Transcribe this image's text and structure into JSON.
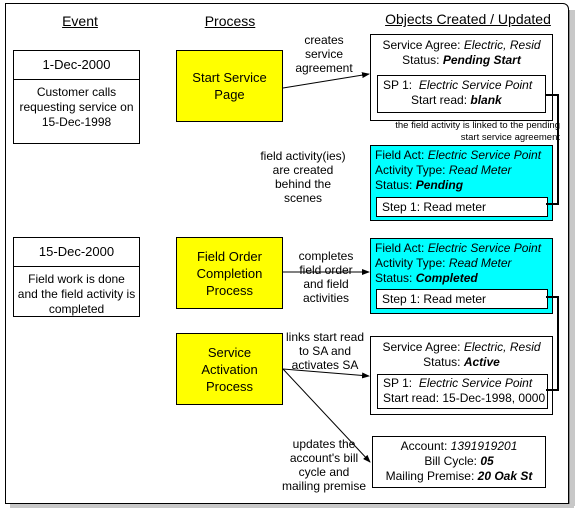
{
  "headers": {
    "event": "Event",
    "process": "Process",
    "objects": "Objects Created / Updated"
  },
  "events": [
    {
      "date": "1-Dec-2000",
      "description_lines": [
        "Customer calls",
        "requesting service on",
        "15-Dec-1998"
      ]
    },
    {
      "date": "15-Dec-2000",
      "description_lines": [
        "Field work is done",
        "and the field activity is",
        "completed"
      ]
    }
  ],
  "processes": [
    {
      "lines": [
        "Start Service",
        "Page"
      ]
    },
    {
      "lines": [
        "Field Order",
        "Completion",
        "Process"
      ]
    },
    {
      "lines": [
        "Service",
        "Activation",
        "Process"
      ]
    }
  ],
  "annotations": {
    "creates_sa": [
      "creates",
      "service",
      "agreement"
    ],
    "field_activity_linked": [
      "the field activity is linked to the pending",
      "start service agreement"
    ],
    "fa_created": [
      "field activity(ies)",
      "are created",
      "behind the",
      "scenes"
    ],
    "completes_fo": [
      "completes",
      "field order",
      "and field",
      "activities"
    ],
    "links_start_read": [
      "links start read",
      "to SA and",
      "activates SA"
    ],
    "updates_account": [
      "updates the",
      "account's bill",
      "cycle and",
      "mailing premise"
    ]
  },
  "objects": {
    "sa_pending": {
      "label1": "Service Agree: ",
      "value1": "Electric, Resid",
      "label2": "Status: ",
      "value2": "Pending Start",
      "sp": {
        "label1": "SP 1:  ",
        "value1": "Electric Service Point",
        "label2": "Start read: ",
        "value2": "blank"
      }
    },
    "fa_pending": {
      "label1": "Field Act: ",
      "value1": "Electric Service Point",
      "label2": "Activity Type: ",
      "value2": "Read Meter",
      "label3": "Status: ",
      "value3": "Pending",
      "step": "Step 1: Read meter"
    },
    "fa_completed": {
      "label1": "Field Act: ",
      "value1": "Electric Service Point",
      "label2": "Activity Type: ",
      "value2": "Read Meter",
      "label3": "Status: ",
      "value3": "Completed",
      "step": "Step 1: Read meter"
    },
    "sa_active": {
      "label1": "Service Agree: ",
      "value1": "Electric, Resid",
      "label2": "Status: ",
      "value2": "Active",
      "sp": {
        "label1": "SP 1:  ",
        "value1": "Electric Service Point",
        "label2": "Start read: ",
        "value2": "15-Dec-1998, 0000"
      }
    },
    "account": {
      "label1": "Account: ",
      "value1": "1391919201",
      "label2": "Bill Cycle: ",
      "value2": "05",
      "label3": "Mailing Premise: ",
      "value3": "20 Oak St"
    }
  },
  "colors": {
    "process_fill": "#ffff00",
    "field_activity_fill": "#00ffff"
  }
}
